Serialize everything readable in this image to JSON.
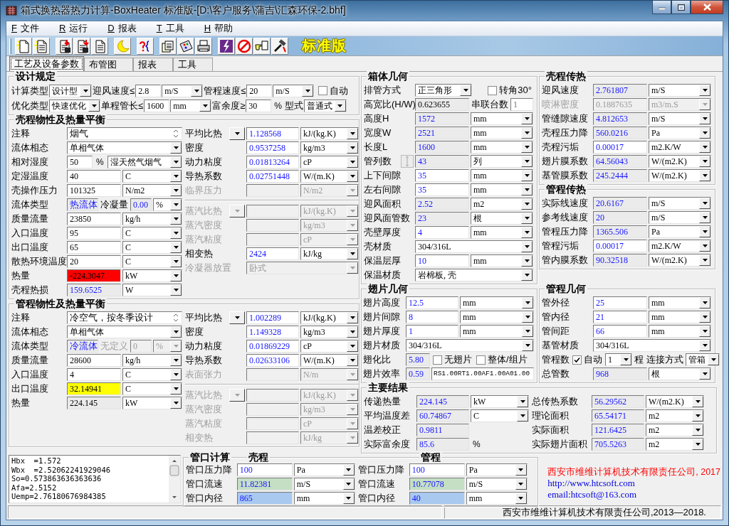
{
  "window": {
    "title": "箱式换热器热力计算-BoxHeater 标准版-[D:\\客户服务\\蒲吉\\汇森环保-2.bhf]",
    "edition": "标准版"
  },
  "menu": [
    {
      "key": "F",
      "label": "文件"
    },
    {
      "key": "R",
      "label": "运行"
    },
    {
      "key": "D",
      "label": "报表"
    },
    {
      "key": "T",
      "label": "工具"
    },
    {
      "key": "H",
      "label": "帮助"
    }
  ],
  "tabs": [
    {
      "label": "工艺及设备参数",
      "selected": true
    },
    {
      "label": "布管图",
      "selected": false
    },
    {
      "label": "报表",
      "selected": false
    },
    {
      "label": "工具",
      "selected": false
    }
  ],
  "design": {
    "title": "设计规定",
    "lines": [
      [
        {
          "kind": "label",
          "text": "计算类型"
        },
        {
          "kind": "select",
          "value": "设计型"
        },
        {
          "kind": "label",
          "text": "迎风速度≤"
        },
        {
          "kind": "entry",
          "value": "2.8"
        },
        {
          "kind": "select",
          "value": "m/S"
        },
        {
          "kind": "label",
          "text": "管程速度≤"
        },
        {
          "kind": "entry",
          "value": "20"
        },
        {
          "kind": "select",
          "value": "m/S"
        },
        {
          "kind": "check",
          "label": "自动",
          "checked": false
        }
      ],
      [
        {
          "kind": "label",
          "text": "优化类型"
        },
        {
          "kind": "select",
          "value": "快速优化"
        },
        {
          "kind": "label",
          "text": "单程管长≤"
        },
        {
          "kind": "entry",
          "value": "1600"
        },
        {
          "kind": "select",
          "value": "mm"
        },
        {
          "kind": "label",
          "text": "富余度≥"
        },
        {
          "kind": "entry",
          "value": "30"
        },
        {
          "kind": "text",
          "text": "%"
        },
        {
          "kind": "label",
          "text": "型式"
        },
        {
          "kind": "select",
          "value": "普通式"
        }
      ]
    ]
  },
  "shell": {
    "title": "壳程物性及热量平衡",
    "left": [
      {
        "kind": "note",
        "label": "注释",
        "value": "烟气"
      },
      {
        "kind": "select",
        "label": "流体相态",
        "value": "单相气体"
      },
      {
        "kind": "field",
        "label": "相对湿度",
        "value": "50",
        "suffix": "%",
        "unit": "湿天然气烟气",
        "readonly": false,
        "computed": false
      },
      {
        "kind": "field",
        "label": "定湿温度",
        "value": "40",
        "unit": "C",
        "readonly": false,
        "computed": false
      },
      {
        "kind": "field",
        "label": "壳操作压力",
        "value": "101325",
        "unit": "N/m2",
        "readonly": false,
        "computed": false
      },
      {
        "kind": "fluid_type",
        "label": "流体类型",
        "value": "热流体",
        "readonly": true,
        "computed": true,
        "sub_label": "冷凝量",
        "sub_value": "0.00",
        "sub_unit": "%",
        "sub_disabled": false
      },
      {
        "kind": "field",
        "label": "质量流量",
        "value": "23850",
        "unit": "kg/h",
        "readonly": false,
        "computed": false
      },
      {
        "kind": "field",
        "label": "入口温度",
        "value": "95",
        "unit": "C",
        "readonly": false,
        "computed": false
      },
      {
        "kind": "field",
        "label": "出口温度",
        "value": "65",
        "unit": "C",
        "readonly": false,
        "computed": false
      },
      {
        "kind": "field",
        "label": "散热环境温度",
        "value": "20",
        "unit": "C",
        "readonly": false,
        "computed": false
      },
      {
        "kind": "field",
        "label": "热量",
        "value": "-224.3047",
        "unit": "kW",
        "computed": false,
        "color": "#ff0000"
      },
      {
        "kind": "field",
        "label": "壳程热损",
        "value": "159.6525",
        "unit": "W",
        "readonly": true,
        "computed": true
      }
    ],
    "right": [
      {
        "kind": "field",
        "label": "平均比热",
        "picker": true,
        "value": "1.128568",
        "unit": "kJ/(kg.K)",
        "readonly": false,
        "computed": true,
        "disabled": false
      },
      {
        "kind": "field",
        "label": "密度",
        "value": "0.9537258",
        "unit": "kg/m3",
        "readonly": false,
        "computed": true,
        "disabled": false
      },
      {
        "kind": "field",
        "label": "动力粘度",
        "value": "0.01813264",
        "unit": "cP",
        "readonly": false,
        "computed": true,
        "disabled": false
      },
      {
        "kind": "field",
        "label": "导热系数",
        "value": "0.02751448",
        "unit": "W/(m.K)",
        "readonly": false,
        "computed": true,
        "disabled": false
      },
      {
        "kind": "field",
        "label": "临界压力",
        "unit": "N/m2",
        "readonly": true,
        "computed": false,
        "disabled": true
      },
      {
        "kind": "rule"
      },
      {
        "kind": "field",
        "label": "蒸汽比热",
        "picker": true,
        "unit": "kJ/(kg.K)",
        "readonly": false,
        "computed": false,
        "disabled": true
      },
      {
        "kind": "field",
        "label": "蒸汽密度",
        "unit": "kg/m3",
        "readonly": false,
        "computed": false,
        "disabled": true
      },
      {
        "kind": "field",
        "label": "蒸汽粘度",
        "unit": "cP",
        "readonly": false,
        "computed": false,
        "disabled": true
      },
      {
        "kind": "field",
        "label": "相变热",
        "value": "2424",
        "unit": "kJ/kg",
        "readonly": false,
        "computed": true,
        "disabled": false
      },
      {
        "kind": "select",
        "label": "冷凝器放置",
        "value": "卧式",
        "disabled": true
      }
    ]
  },
  "tube": {
    "title": "管程物性及热量平衡",
    "left": [
      {
        "kind": "note",
        "label": "注释",
        "value": "冷空气，按冬季设计"
      },
      {
        "kind": "select",
        "label": "流体相态",
        "value": "单相气体"
      },
      {
        "kind": "fluid_type",
        "label": "流体类型",
        "value": "冷流体",
        "readonly": true,
        "computed": true,
        "sub_label": "无定义",
        "sub_value": "0",
        "sub_unit": "%",
        "sub_disabled": true
      },
      {
        "kind": "field",
        "label": "质量流量",
        "value": "28600",
        "unit": "kg/h",
        "readonly": false,
        "computed": false
      },
      {
        "kind": "field",
        "label": "入口温度",
        "value": "4",
        "unit": "C",
        "readonly": false,
        "computed": false
      },
      {
        "kind": "field",
        "label": "出口温度",
        "value": "32.14941",
        "unit": "C",
        "computed": false,
        "color": "#ffff00"
      },
      {
        "kind": "field",
        "label": "热量",
        "value": "224.145",
        "unit": "kW",
        "readonly": true,
        "computed": false
      }
    ],
    "right": [
      {
        "kind": "field",
        "label": "平均比热",
        "picker": true,
        "value": "1.002289",
        "unit": "kJ/(kg.K)",
        "readonly": false,
        "computed": true,
        "disabled": false
      },
      {
        "kind": "field",
        "label": "密度",
        "value": "1.149328",
        "unit": "kg/m3",
        "readonly": false,
        "computed": true,
        "disabled": false
      },
      {
        "kind": "field",
        "label": "动力粘度",
        "value": "0.01869229",
        "unit": "cP",
        "readonly": false,
        "computed": true,
        "disabled": false
      },
      {
        "kind": "field",
        "label": "导热系数",
        "value": "0.02633106",
        "unit": "W/(m.K)",
        "readonly": false,
        "computed": true,
        "disabled": false
      },
      {
        "kind": "field",
        "label": "表面张力",
        "unit": "N/m",
        "readonly": true,
        "computed": false,
        "disabled": true
      },
      {
        "kind": "rule"
      },
      {
        "kind": "field",
        "label": "蒸汽比热",
        "picker": true,
        "unit": "kJ/(kg.K)",
        "readonly": false,
        "computed": false,
        "disabled": true
      },
      {
        "kind": "field",
        "label": "蒸汽密度",
        "unit": "kg/m3",
        "readonly": false,
        "computed": false,
        "disabled": true
      },
      {
        "kind": "field",
        "label": "蒸汽粘度",
        "unit": "cP",
        "readonly": false,
        "computed": false,
        "disabled": true
      },
      {
        "kind": "field",
        "label": "相变热",
        "unit": "kJ/kg",
        "readonly": false,
        "computed": false,
        "disabled": true
      }
    ]
  },
  "box_geometry": {
    "title": "箱体几何",
    "rows": [
      {
        "kind": "select_check",
        "label": "排管方式",
        "value": "正三角形",
        "check": {
          "label": "转角30°",
          "checked": false
        }
      },
      {
        "kind": "pair",
        "label": "高宽比(H/W)",
        "value": "0.623655",
        "readonly": true,
        "computed": false,
        "sub_label": "串联台数",
        "sub_value": "1"
      },
      {
        "kind": "field",
        "label": "高度H",
        "value": "1572",
        "unit": "mm",
        "readonly": true,
        "computed": true
      },
      {
        "kind": "field",
        "label": "宽度W",
        "value": "2521",
        "unit": "mm",
        "readonly": true,
        "computed": true
      },
      {
        "kind": "field",
        "label": "长度L",
        "value": "1600",
        "unit": "mm",
        "readonly": true,
        "computed": true
      },
      {
        "kind": "field",
        "label": "管列数",
        "spinner": true,
        "value": "43",
        "unit": "列",
        "readonly": true,
        "computed": true
      },
      {
        "kind": "field",
        "label": "上下间隙",
        "value": "35",
        "unit": "mm",
        "readonly": false,
        "computed": true
      },
      {
        "kind": "field",
        "label": "左右间隙",
        "value": "35",
        "unit": "mm",
        "readonly": false,
        "computed": true
      },
      {
        "kind": "field",
        "label": "迎风面积",
        "value": "2.52",
        "unit": "m2",
        "readonly": true,
        "computed": true
      },
      {
        "kind": "field",
        "label": "迎风面管数",
        "value": "23",
        "unit": "根",
        "readonly": true,
        "computed": true
      },
      {
        "kind": "field",
        "label": "壳壁厚度",
        "value": "4",
        "unit": "mm",
        "readonly": false,
        "computed": true
      },
      {
        "kind": "select",
        "label": "壳材质",
        "value": "304/316L"
      },
      {
        "kind": "field",
        "label": "保温层厚",
        "value": "10",
        "unit": "mm",
        "readonly": false,
        "computed": true
      },
      {
        "kind": "select",
        "label": "保温材质",
        "value": "岩棉板, 壳"
      }
    ]
  },
  "shell_transfer": {
    "title": "壳程传热",
    "rows": [
      {
        "kind": "field",
        "label": "迎风速度",
        "value": "2.761807",
        "unit": "m/S",
        "readonly": true,
        "computed": true,
        "disabled": false
      },
      {
        "kind": "field",
        "label": "喷淋密度",
        "value": "0.1887635",
        "unit": "m3/m.S",
        "readonly": true,
        "computed": false,
        "disabled": true
      },
      {
        "kind": "field",
        "label": "管缝隙速度",
        "value": "4.812653",
        "unit": "m/S",
        "readonly": true,
        "computed": true,
        "disabled": false
      },
      {
        "kind": "field",
        "label": "壳程压力降",
        "value": "560.0216",
        "unit": "Pa",
        "readonly": true,
        "computed": true,
        "disabled": false
      },
      {
        "kind": "field",
        "label": "壳程污垢",
        "value": "0.00017",
        "unit": "m2.K/W",
        "readonly": false,
        "computed": true,
        "disabled": false
      },
      {
        "kind": "field",
        "label": "翅片膜系数",
        "value": "64.56043",
        "unit": "W/(m2.K)",
        "readonly": true,
        "computed": true,
        "disabled": false
      },
      {
        "kind": "field",
        "label": "基管膜系数",
        "value": "245.2444",
        "unit": "W/(m2.K)",
        "readonly": true,
        "computed": true,
        "disabled": false
      }
    ]
  },
  "tube_transfer": {
    "title": "管程传热",
    "rows": [
      {
        "kind": "field",
        "label": "实际线速度",
        "value": "20.6167",
        "unit": "m/S",
        "readonly": true,
        "computed": true
      },
      {
        "kind": "field",
        "label": "参考线速度",
        "value": "20",
        "unit": "m/S",
        "readonly": true,
        "computed": true
      },
      {
        "kind": "field",
        "label": "管程压力降",
        "value": "1365.506",
        "unit": "Pa",
        "readonly": true,
        "computed": true
      },
      {
        "kind": "field",
        "label": "管程污垢",
        "value": "0.00017",
        "unit": "m2.K/W",
        "readonly": false,
        "computed": true
      },
      {
        "kind": "field",
        "label": "管内膜系数",
        "value": "90.32518",
        "unit": "W/(m2.K)",
        "readonly": true,
        "computed": true
      }
    ]
  },
  "fin_geometry": {
    "title": "翅片几何",
    "rows": [
      {
        "kind": "field",
        "label": "翅片高度",
        "value": "12.5",
        "unit": "mm",
        "readonly": false,
        "computed": true
      },
      {
        "kind": "field",
        "label": "翅片间隙",
        "value": "8",
        "unit": "mm",
        "readonly": false,
        "computed": true
      },
      {
        "kind": "field",
        "label": "翅片厚度",
        "value": "1",
        "unit": "mm",
        "readonly": false,
        "computed": true
      },
      {
        "kind": "select",
        "label": "翅片材质",
        "value": "304/316L"
      },
      {
        "kind": "value_checks",
        "label": "翅化比",
        "value": "5.80",
        "readonly": true,
        "computed": true,
        "checks": [
          {
            "label": "无翅片",
            "checked": false
          },
          {
            "label": "整体/组片",
            "checked": false
          }
        ]
      },
      {
        "kind": "value_text",
        "label": "翅片效率",
        "value": "0.59",
        "readonly": true,
        "computed": true,
        "text": "RS1.00RT1.00AF1.00A01.00"
      }
    ]
  },
  "tube_geometry": {
    "title": "管程几何",
    "rows": [
      {
        "kind": "field",
        "label": "管外径",
        "value": "25",
        "unit": "mm",
        "readonly": false,
        "computed": true
      },
      {
        "kind": "field",
        "label": "管内径",
        "value": "21",
        "unit": "mm",
        "readonly": false,
        "computed": true
      },
      {
        "kind": "field",
        "label": "管间距",
        "value": "66",
        "unit": "mm",
        "readonly": false,
        "computed": true
      },
      {
        "kind": "select",
        "label": "基管材质",
        "value": "304/316L"
      },
      {
        "kind": "passes",
        "label": "管程数",
        "auto": {
          "label": "自动",
          "checked": true
        },
        "value": "1",
        "suffix": "程",
        "sub_label": "连接方式",
        "sub_value": "管箱"
      },
      {
        "kind": "field",
        "label": "总管数",
        "value": "968",
        "unit": "根",
        "readonly": true,
        "computed": true
      }
    ]
  },
  "results": {
    "title": "主要结果",
    "left": [
      {
        "kind": "field",
        "label": "传递热量",
        "value": "224.145",
        "unit": "kW",
        "readonly": true,
        "computed": true
      },
      {
        "kind": "field",
        "label": "平均温度差",
        "value": "60.74867",
        "unit": "C",
        "readonly": true,
        "computed": true
      },
      {
        "kind": "field",
        "label": "温差校正",
        "value": "0.9811",
        "readonly": true,
        "computed": true
      },
      {
        "kind": "field",
        "label": "实际富余度",
        "value": "85.6",
        "suffix": "%",
        "readonly": true,
        "computed": true
      }
    ],
    "right": [
      {
        "kind": "field",
        "label": "总传热系数",
        "value": "56.29562",
        "unit": "W/(m2.K)",
        "readonly": true,
        "computed": true
      },
      {
        "kind": "field",
        "label": "理论面积",
        "value": "65.54171",
        "unit": "m2",
        "readonly": true,
        "computed": true
      },
      {
        "kind": "field",
        "label": "实际面积",
        "value": "121.6425",
        "unit": "m2",
        "readonly": true,
        "computed": true
      },
      {
        "kind": "field",
        "label": "实际翅片面积",
        "value": "705.5263",
        "unit": "m2",
        "readonly": true,
        "computed": true
      }
    ]
  },
  "log": {
    "lines": [
      "Hbx  =1.572",
      "Wbx  =2.52062241929046",
      "So=0.573863636363636",
      "Afa=2.5152",
      "Uemp=2.76180676984385"
    ]
  },
  "nozzles": {
    "title": "管口计算",
    "columns": [
      {
        "heading": "壳程",
        "rows": [
          {
            "kind": "field",
            "label": "管口压力降",
            "value": "100",
            "unit": "Pa",
            "readonly": false,
            "computed": true
          },
          {
            "kind": "field",
            "label": "管口流速",
            "value": "11.82381",
            "unit": "m/S",
            "computed": true,
            "color": "#c5dfc5"
          },
          {
            "kind": "field",
            "label": "管口内径",
            "value": "865",
            "unit": "mm",
            "computed": true,
            "color": "#a9c9ef"
          }
        ]
      },
      {
        "heading": "管程",
        "rows": [
          {
            "kind": "field",
            "label": "管口压力降",
            "value": "100",
            "unit": "Pa",
            "readonly": false,
            "computed": true
          },
          {
            "kind": "field",
            "label": "管口流速",
            "value": "10.77078",
            "unit": "m/S",
            "computed": true,
            "color": "#c5dfc5"
          },
          {
            "kind": "field",
            "label": "管口内径",
            "value": "40",
            "unit": "mm",
            "computed": true,
            "color": "#a9c9ef"
          }
        ]
      }
    ]
  },
  "company": {
    "name": "西安市维维计算机技术有限责任公司, 2017",
    "url": "http://www.htcsoft.com",
    "email": "email:htcsoft@163.com"
  },
  "status_bar": {
    "text": "西安市维维计算机技术有限责任公司,2013—2018."
  }
}
